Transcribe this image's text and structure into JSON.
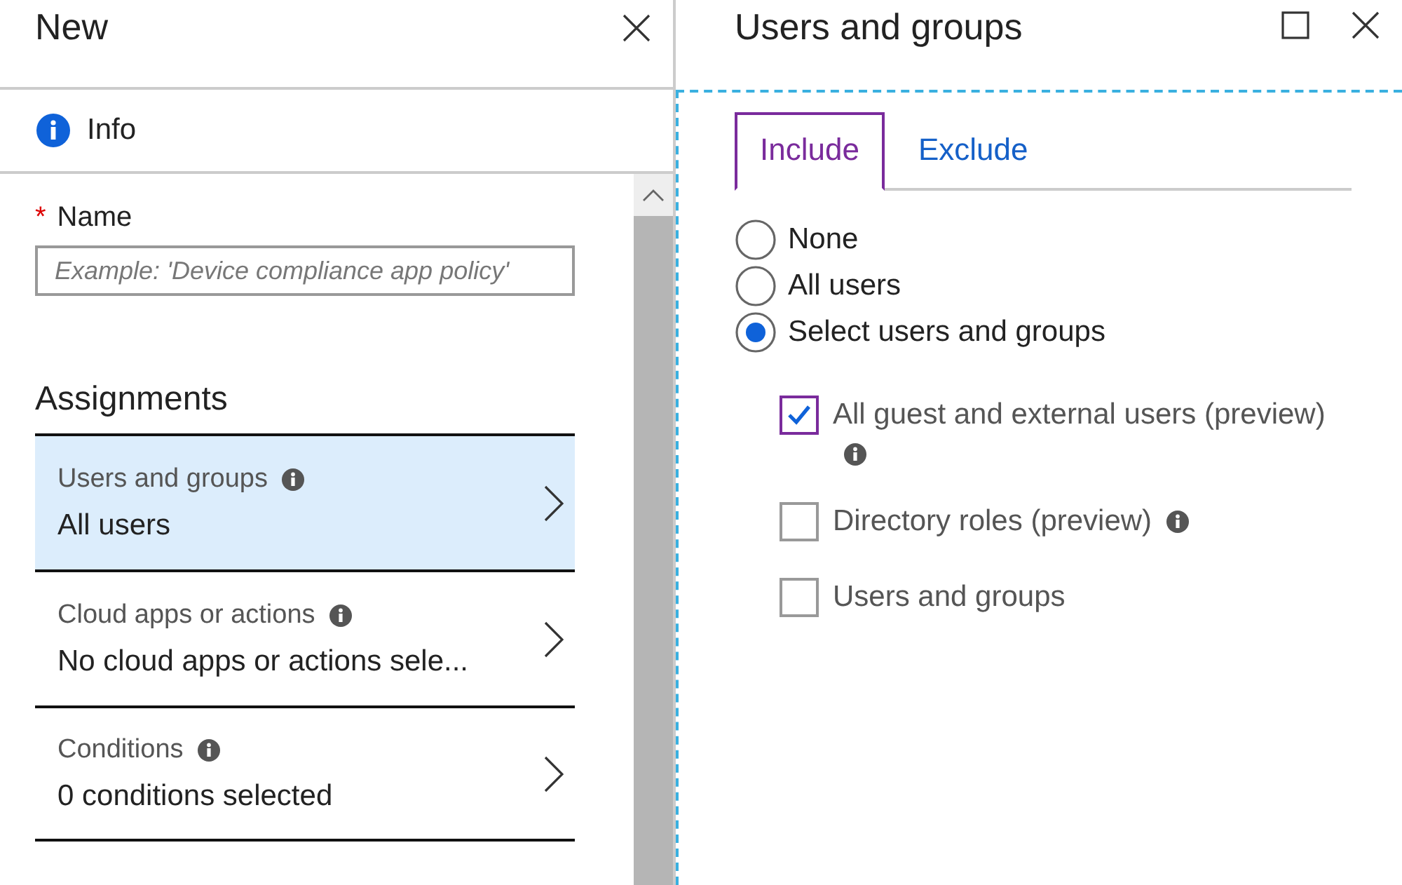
{
  "left_panel": {
    "title": "New",
    "info_link": "Info",
    "name_field": {
      "label": "Name",
      "required_mark": "*",
      "placeholder": "Example: 'Device compliance app policy'"
    },
    "section_title": "Assignments",
    "assignments": [
      {
        "label": "Users and groups",
        "value": "All users",
        "selected": true
      },
      {
        "label": "Cloud apps or actions",
        "value": "No cloud apps or actions sele...",
        "selected": false
      },
      {
        "label": "Conditions",
        "value": "0 conditions selected",
        "selected": false
      }
    ]
  },
  "right_panel": {
    "title": "Users and groups",
    "tabs": [
      {
        "label": "Include",
        "selected": true
      },
      {
        "label": "Exclude",
        "selected": false
      }
    ],
    "radios": [
      {
        "label": "None",
        "selected": false
      },
      {
        "label": "All users",
        "selected": false
      },
      {
        "label": "Select users and groups",
        "selected": true
      }
    ],
    "checkboxes": [
      {
        "label": "All guest and external users (preview)",
        "checked": true,
        "info": true
      },
      {
        "label": "Directory roles (preview)",
        "checked": false,
        "info": true
      },
      {
        "label": "Users and groups",
        "checked": false,
        "info": false
      }
    ]
  }
}
